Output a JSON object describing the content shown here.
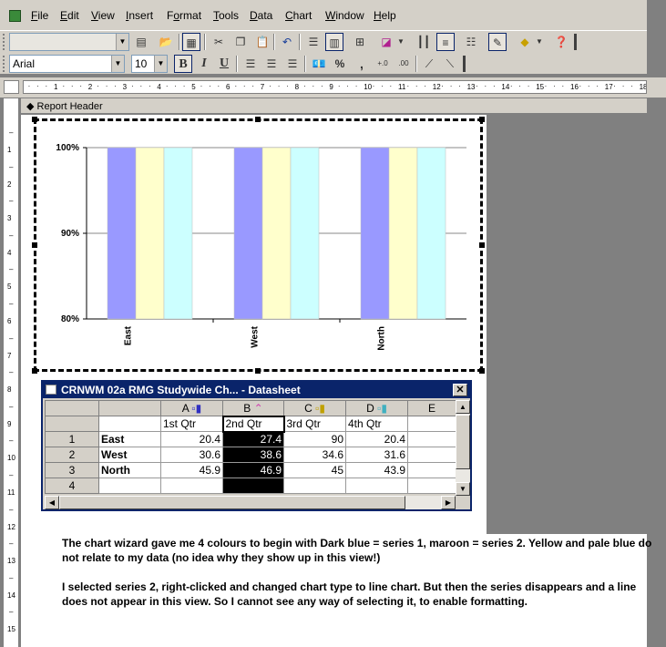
{
  "menu": [
    "File",
    "Edit",
    "View",
    "Insert",
    "Format",
    "Tools",
    "Data",
    "Chart",
    "Window",
    "Help"
  ],
  "menu_mnemonic": [
    "F",
    "E",
    "V",
    "I",
    "o",
    "T",
    "D",
    "C",
    "W",
    "H"
  ],
  "toolbar": {
    "font_name": "Arial",
    "font_size": "10",
    "bold": "B",
    "italic": "I",
    "underline": "U",
    "percent": "%",
    "comma": ","
  },
  "ruler": {
    "h_ticks": [
      "1",
      "2",
      "3",
      "4",
      "5",
      "6",
      "7",
      "8",
      "9",
      "10",
      "11",
      "12",
      "13",
      "14",
      "15",
      "16",
      "17",
      "18"
    ],
    "v_ticks": [
      "1",
      "2",
      "3",
      "4",
      "5",
      "6",
      "7",
      "8",
      "9",
      "10",
      "11",
      "12",
      "13",
      "14",
      "15"
    ]
  },
  "section": {
    "label": "Report Header"
  },
  "chart_data": {
    "type": "bar",
    "categories": [
      "East",
      "West",
      "North"
    ],
    "series": [
      {
        "color": "#9999ff",
        "values": [
          100,
          100,
          100
        ]
      },
      {
        "color": "#ffffcc",
        "values": [
          100,
          100,
          100
        ]
      },
      {
        "color": "#ccffff",
        "values": [
          100,
          100,
          100
        ]
      }
    ],
    "yticks": [
      "100%",
      "90%",
      "80%"
    ],
    "ylim": [
      80,
      100
    ],
    "grid": true
  },
  "datasheet": {
    "title": "CRNWM 02a RMG Studywide Ch... - Datasheet",
    "columns": [
      "A",
      "B",
      "C",
      "D",
      "E"
    ],
    "series_labels": [
      "1st Qtr",
      "2nd Qtr",
      "3rd Qtr",
      "4th Qtr",
      ""
    ],
    "row_numbers": [
      "1",
      "2",
      "3",
      "4"
    ],
    "rows": [
      {
        "label": "East",
        "values": [
          "20.4",
          "27.4",
          "90",
          "20.4",
          ""
        ]
      },
      {
        "label": "West",
        "values": [
          "30.6",
          "38.6",
          "34.6",
          "31.6",
          ""
        ]
      },
      {
        "label": "North",
        "values": [
          "45.9",
          "46.9",
          "45",
          "43.9",
          ""
        ]
      },
      {
        "label": "",
        "values": [
          "",
          "",
          "",
          "",
          ""
        ]
      }
    ]
  },
  "note": {
    "p1": "The chart wizard gave me 4 colours to begin with   Dark blue = series 1, maroon = series 2.  Yellow and pale blue do not relate to my data (no idea why they show up in this view!)",
    "p2": "I selected series 2, right-clicked and changed chart type to line chart.  But then the series disappears and a line does not appear in this view.  So I cannot see any way of selecting it, to enable formatting."
  }
}
